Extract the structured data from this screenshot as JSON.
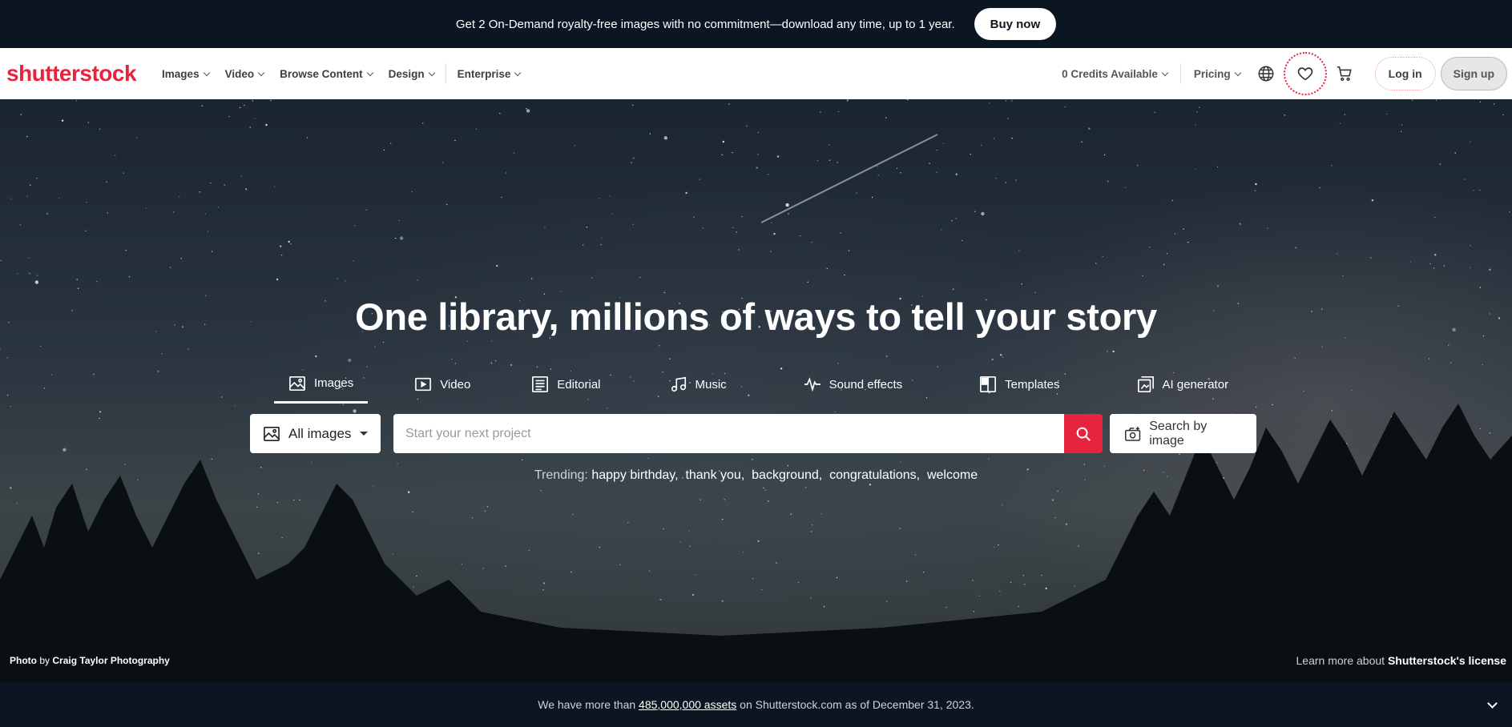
{
  "promo": {
    "text": "Get 2 On-Demand royalty-free images with no commitment—download any time, up to 1 year.",
    "button": "Buy now"
  },
  "header": {
    "logo": "shutterstock",
    "nav": [
      "Images",
      "Video",
      "Browse Content",
      "Design",
      "Enterprise"
    ],
    "credits": "0 Credits Available",
    "pricing": "Pricing",
    "login": "Log in",
    "signup": "Sign up"
  },
  "hero": {
    "title": "One library, millions of ways to tell your story",
    "tabs": [
      "Images",
      "Video",
      "Editorial",
      "Music",
      "Sound effects",
      "Templates",
      "AI generator"
    ],
    "select": "All images",
    "search_placeholder": "Start your next project",
    "image_search": "Search by image",
    "trending_label": "Trending:",
    "trending": [
      "happy birthday,",
      "thank you,",
      "background,",
      "congratulations,",
      "welcome"
    ],
    "credit_photo": "Photo",
    "credit_by": "by",
    "credit_name": "Craig Taylor Photography",
    "license_prefix": "Learn more about",
    "license_link": "Shutterstock's license"
  },
  "footer": {
    "prefix": "We have more than",
    "assets": "485,000,000 assets",
    "suffix": "on Shutterstock.com as of December 31, 2023."
  },
  "colors": {
    "brand": "#e8233f",
    "dark": "#0b1622"
  }
}
